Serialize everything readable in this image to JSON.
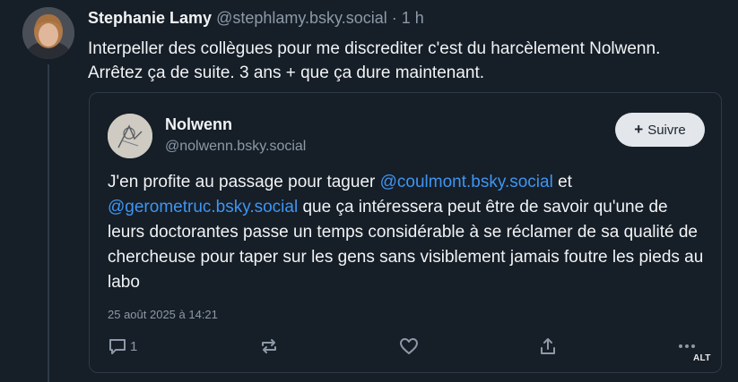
{
  "post": {
    "author_name": "Stephanie Lamy",
    "author_handle": "@stephlamy.bsky.social",
    "separator": "·",
    "time": "1 h",
    "text": "Interpeller des collègues pour me discrediter c'est du harcèlement Nolwenn. Arrêtez ça de suite. 3 ans + que ça dure maintenant."
  },
  "quote": {
    "author_name": "Nolwenn",
    "author_handle": "@nolwenn.bsky.social",
    "follow_label": "Suivre",
    "follow_icon": "plus-icon",
    "text_part1": "J'en profite au passage pour taguer ",
    "mention1": "@coulmont.bsky.social",
    "text_part2": " et ",
    "mention2": "@gerometruc.bsky.social",
    "text_part3": " que ça intéressera peut être de savoir qu'une de leurs doctorantes passe un temps considérable à se réclamer de sa qualité de chercheuse pour taper sur les gens sans visiblement jamais foutre les pieds au labo",
    "date": "25 août 2025 à 14:21",
    "reply_count": "1",
    "accent_color": "#3e95f2"
  },
  "icons": {
    "reply": "reply-icon",
    "repost": "repost-icon",
    "like": "heart-icon",
    "share": "share-icon",
    "more": "more-icon"
  },
  "alt_badge": "ALT"
}
